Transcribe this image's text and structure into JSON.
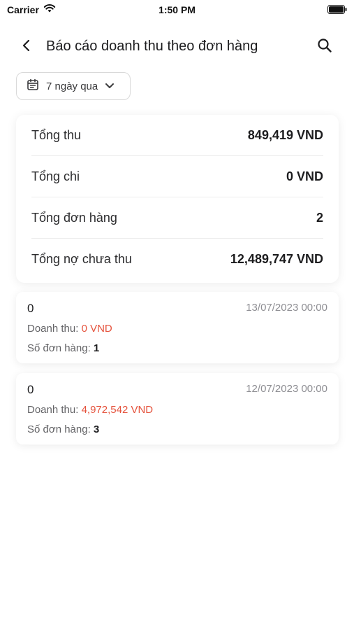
{
  "status_bar": {
    "carrier": "Carrier",
    "time": "1:50 PM"
  },
  "header": {
    "title": "Báo cáo doanh thu theo đơn hàng"
  },
  "filter": {
    "label": "7 ngày qua"
  },
  "summary": [
    {
      "label": "Tổng thu",
      "value": "849,419 VND"
    },
    {
      "label": "Tổng chi",
      "value": "0 VND"
    },
    {
      "label": "Tổng đơn hàng",
      "value": "2"
    },
    {
      "label": "Tổng nợ chưa thu",
      "value": "12,489,747 VND"
    }
  ],
  "orders": [
    {
      "name": "0",
      "date": "13/07/2023 00:00",
      "revenue_label": "Doanh thu:",
      "revenue": "0 VND",
      "count_label": "Số đơn hàng:",
      "count": "1"
    },
    {
      "name": "0",
      "date": "12/07/2023 00:00",
      "revenue_label": "Doanh thu:",
      "revenue": "4,972,542 VND",
      "count_label": "Số đơn hàng:",
      "count": "3"
    }
  ],
  "colors": {
    "accent_red": "#e5533d",
    "muted": "#8e8e93"
  }
}
